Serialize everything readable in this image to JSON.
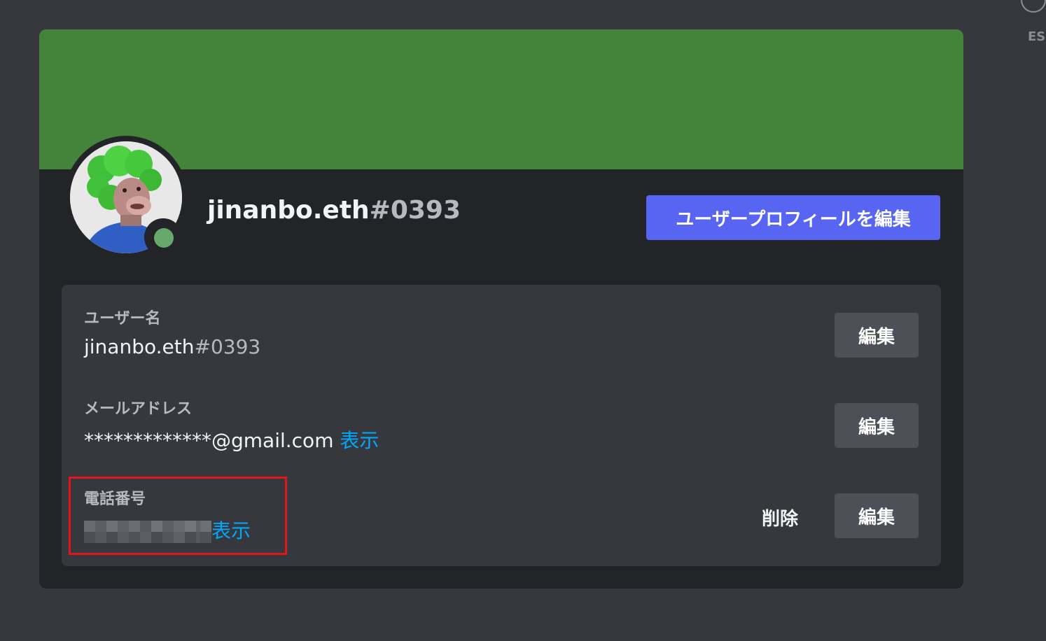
{
  "window": {
    "close_hint": "ES"
  },
  "profile": {
    "username": "jinanbo.eth",
    "discriminator": "#0393",
    "status": "online",
    "status_color": "#67a86b",
    "banner_color": "#43843a",
    "edit_profile_button": "ユーザープロフィールを編集"
  },
  "fields": {
    "username": {
      "label": "ユーザー名",
      "value": "jinanbo.eth",
      "discriminator": "#0393",
      "edit_button": "編集"
    },
    "email": {
      "label": "メールアドレス",
      "value": "*************@gmail.com",
      "reveal_link": "表示",
      "edit_button": "編集"
    },
    "phone": {
      "label": "電話番号",
      "reveal_link": "表示",
      "delete_link": "削除",
      "edit_button": "編集"
    }
  },
  "colors": {
    "accent": "#5865f2",
    "link": "#00a8fc",
    "highlight": "#e4141b"
  }
}
